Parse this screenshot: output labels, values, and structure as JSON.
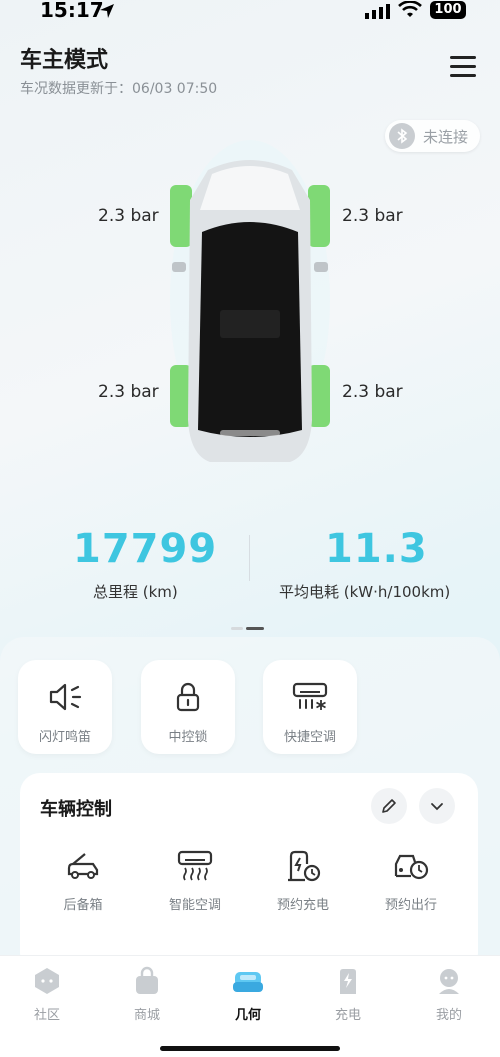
{
  "status_bar": {
    "time": "15:17",
    "battery": "100"
  },
  "header": {
    "title": "车主模式",
    "update_text": "车况数据更新于：06/03 07:50"
  },
  "bluetooth": {
    "label": "未连接"
  },
  "tires": {
    "front_left": "2.3 bar",
    "front_right": "2.3 bar",
    "rear_left": "2.3 bar",
    "rear_right": "2.3 bar"
  },
  "stats": {
    "mileage_value": "17799",
    "mileage_label": "总里程 (km)",
    "consumption_value": "11.3",
    "consumption_label": "平均电耗 (kW·h/100km)"
  },
  "quick_actions": [
    {
      "label": "闪灯鸣笛",
      "icon": "horn-light-icon"
    },
    {
      "label": "中控锁",
      "icon": "lock-icon"
    },
    {
      "label": "快捷空调",
      "icon": "ac-icon"
    }
  ],
  "vehicle_control": {
    "title": "车辆控制",
    "items": [
      {
        "label": "后备箱",
        "icon": "trunk-icon"
      },
      {
        "label": "智能空调",
        "icon": "smart-ac-icon"
      },
      {
        "label": "预约充电",
        "icon": "scheduled-charge-icon"
      },
      {
        "label": "预约出行",
        "icon": "scheduled-trip-icon"
      }
    ]
  },
  "tabbar": [
    {
      "label": "社区",
      "icon": "community-icon",
      "active": false
    },
    {
      "label": "商城",
      "icon": "shop-icon",
      "active": false
    },
    {
      "label": "几何",
      "icon": "car-icon",
      "active": true
    },
    {
      "label": "充电",
      "icon": "charging-icon",
      "active": false
    },
    {
      "label": "我的",
      "icon": "profile-icon",
      "active": false
    }
  ],
  "colors": {
    "accent": "#3ec6e0",
    "tire_ok": "#6fd96a"
  }
}
